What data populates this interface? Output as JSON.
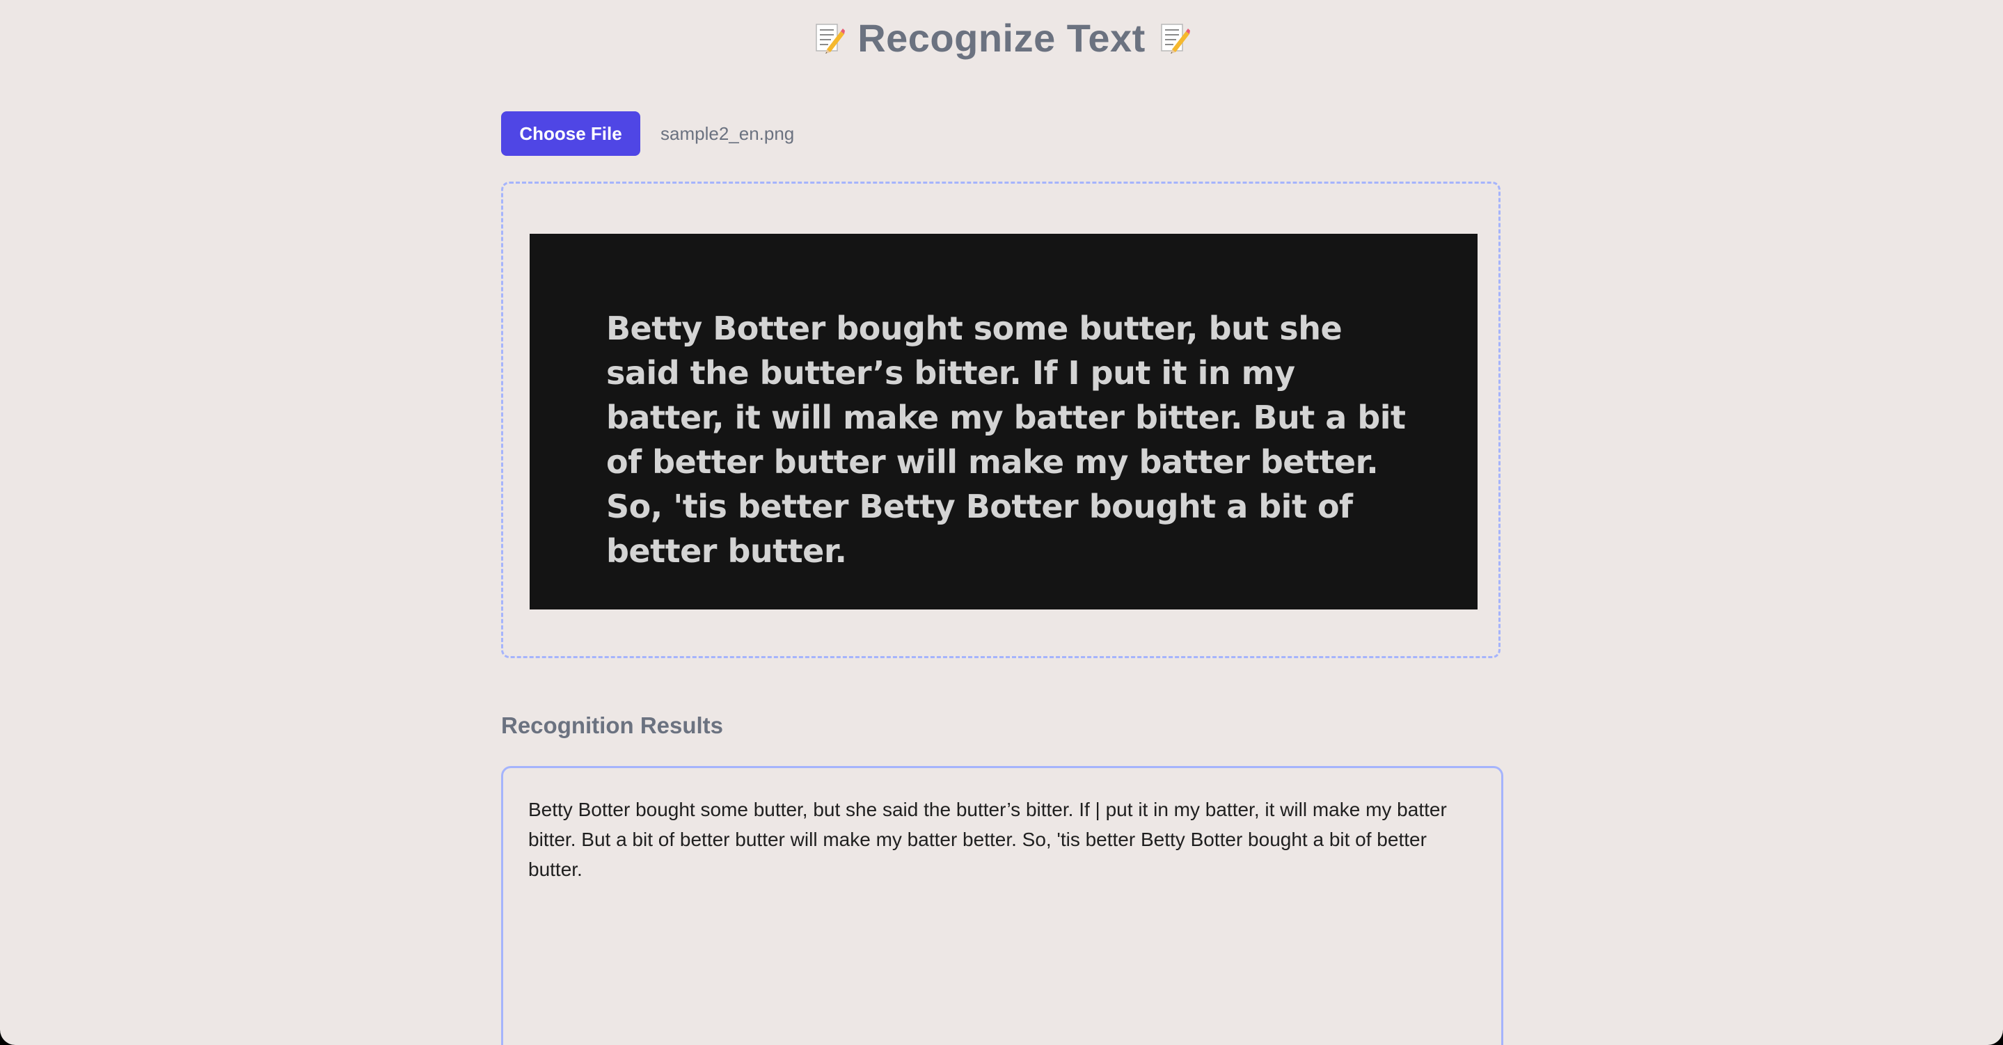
{
  "header": {
    "title": "Recognize Text",
    "icon_left": "memo-icon",
    "icon_right": "memo-icon"
  },
  "file_input": {
    "button_label": "Choose File",
    "file_name": "sample2_en.png"
  },
  "preview": {
    "image_text": "Betty Botter bought some butter, but she said the butter’s bitter. If I put it in my batter, it will make my batter bitter. But a bit of better butter will make my batter better. So, 'tis better Betty Botter bought a bit of better butter."
  },
  "results": {
    "heading": "Recognition Results",
    "text": "Betty Botter bought some butter, but she said the butter’s bitter. If | put it in my batter, it will make my batter bitter. But a bit of better butter will make my batter better. So, 'tis better Betty Botter bought a bit of better butter."
  },
  "colors": {
    "background": "#ede7e5",
    "accent": "#4f46e5",
    "border": "#a5b4fc",
    "heading_text": "#6b7280",
    "preview_background": "#141414"
  }
}
